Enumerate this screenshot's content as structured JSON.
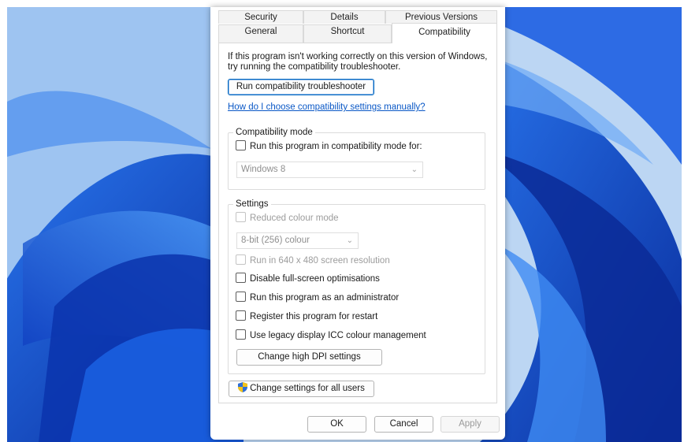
{
  "tabs": {
    "row1": [
      {
        "label": "Security"
      },
      {
        "label": "Details"
      },
      {
        "label": "Previous Versions"
      }
    ],
    "row2": [
      {
        "label": "General"
      },
      {
        "label": "Shortcut"
      },
      {
        "label": "Compatibility",
        "active": true
      }
    ]
  },
  "intro_text": "If this program isn't working correctly on this version of Windows, try running the compatibility troubleshooter.",
  "troubleshooter_button": "Run compatibility troubleshooter",
  "help_link": "How do I choose compatibility settings manually?",
  "compat_mode": {
    "title": "Compatibility mode",
    "checkbox_label": "Run this program in compatibility mode for:",
    "checked": false,
    "selected_os": "Windows 8"
  },
  "settings": {
    "title": "Settings",
    "reduced_colour": {
      "label": "Reduced colour mode",
      "checked": false,
      "disabled": true
    },
    "colour_depth": "8-bit (256) colour",
    "resolution_640": {
      "label": "Run in 640 x 480 screen resolution",
      "checked": false,
      "disabled": true
    },
    "disable_fullscreen": {
      "label": "Disable full-screen optimisations",
      "checked": false
    },
    "run_as_admin": {
      "label": "Run this program as an administrator",
      "checked": false
    },
    "register_restart": {
      "label": "Register this program for restart",
      "checked": false
    },
    "legacy_icc": {
      "label": "Use legacy display ICC colour management",
      "checked": false
    },
    "dpi_button": "Change high DPI settings"
  },
  "all_users_button": "Change settings for all users",
  "footer": {
    "ok": "OK",
    "cancel": "Cancel",
    "apply": "Apply"
  },
  "colors": {
    "link": "#0a58c6",
    "focus_border": "#0067c0",
    "wallpaper_blue": "#1b61e4"
  }
}
